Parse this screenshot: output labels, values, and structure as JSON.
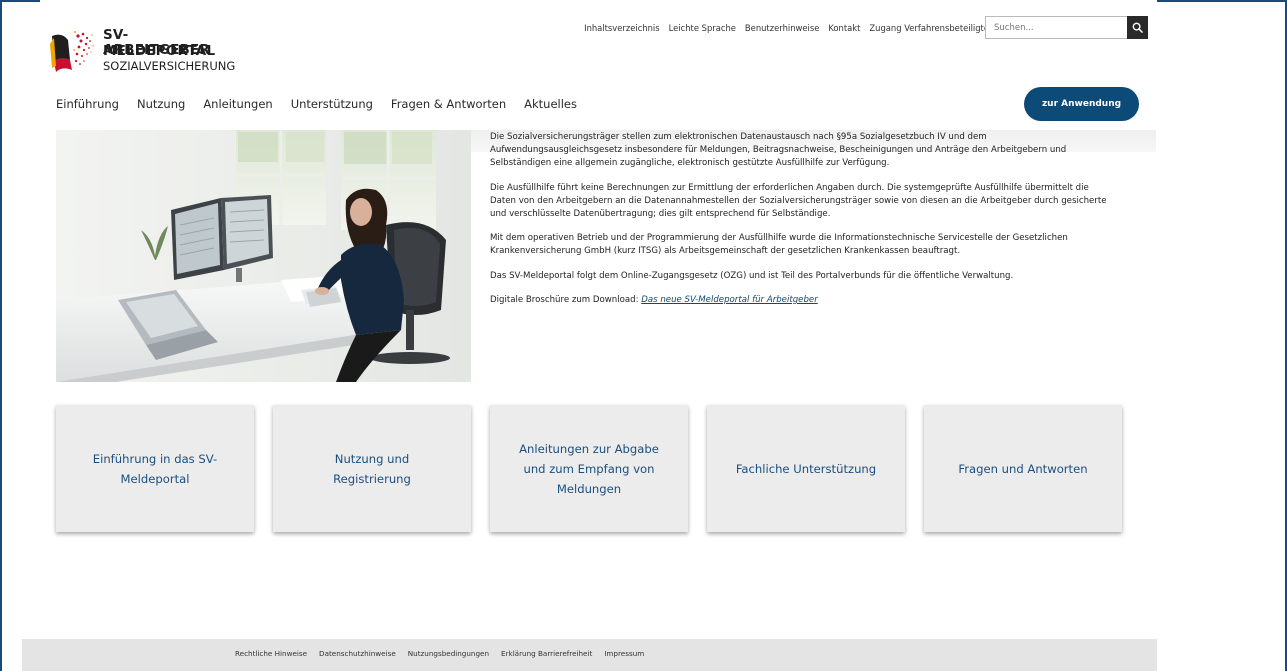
{
  "header": {
    "logo": {
      "line1": "SV-MELDEPORTAL",
      "line2": "ARBEITGEBER",
      "line3": "SOZIALVERSICHERUNG"
    },
    "util_nav": [
      "Inhaltsverzeichnis",
      "Leichte Sprache",
      "Benutzerhinweise",
      "Kontakt",
      "Zugang Verfahrensbeteiligte"
    ],
    "search": {
      "placeholder": "Suchen...",
      "icon": "search-icon"
    },
    "main_nav": [
      "Einführung",
      "Nutzung",
      "Anleitungen",
      "Unterstützung",
      "Fragen & Antworten",
      "Aktuelles"
    ],
    "cta_label": "zur Anwendung",
    "accent_color": "#0c4a78"
  },
  "intro": {
    "paragraphs": [
      "Die Sozialversicherungsträger stellen zum elektronischen Datenaustausch nach §95a Sozialgesetzbuch IV und dem Aufwendungsausgleichsgesetz insbesondere für Meldungen, Beitragsnachweise, Bescheinigungen und Anträge den Arbeitgebern und Selbständigen eine allgemein zugängliche, elektronisch gestützte Ausfüllhilfe zur Verfügung.",
      "Die Ausfüllhilfe führt keine Berechnungen zur Ermittlung der erforderlichen Angaben durch. Die systemgeprüfte Ausfüllhilfe übermittelt die Daten von den Arbeitgebern an die Datenannahmestellen der Sozialversicherungsträger sowie von diesen an die Arbeitgeber durch gesicherte und verschlüsselte Datenübertragung; dies gilt entsprechend für Selbständige.",
      "Mit dem operativen Betrieb und der Programmierung der Ausfüllhilfe wurde die Informationstechnische Servicestelle der Gesetzlichen Krankenversicherung GmbH (kurz ITSG) als Arbeitsgemeinschaft der gesetzlichen Krankenkassen beauftragt.",
      "Das SV-Meldeportal folgt dem Online-Zugangsgesetz (OZG) und ist Teil des Portalverbunds für die öffentliche Verwaltung."
    ],
    "download_prefix": "Digitale Broschüre zum Download: ",
    "download_link": "Das neue SV-Meldeportal für Arbeitgeber"
  },
  "tiles": [
    "Einführung in das SV-Meldeportal",
    "Nutzung und Registrierung",
    "Anleitungen zur Abgabe und zum Empfang von Meldungen",
    "Fachliche Unterstützung",
    "Fragen und Antworten"
  ],
  "footer": {
    "links": [
      "Rechtliche Hinweise",
      "Datenschutzhinweise",
      "Nutzungsbedingungen",
      "Erklärung Barrierefreiheit",
      "Impressum"
    ]
  }
}
